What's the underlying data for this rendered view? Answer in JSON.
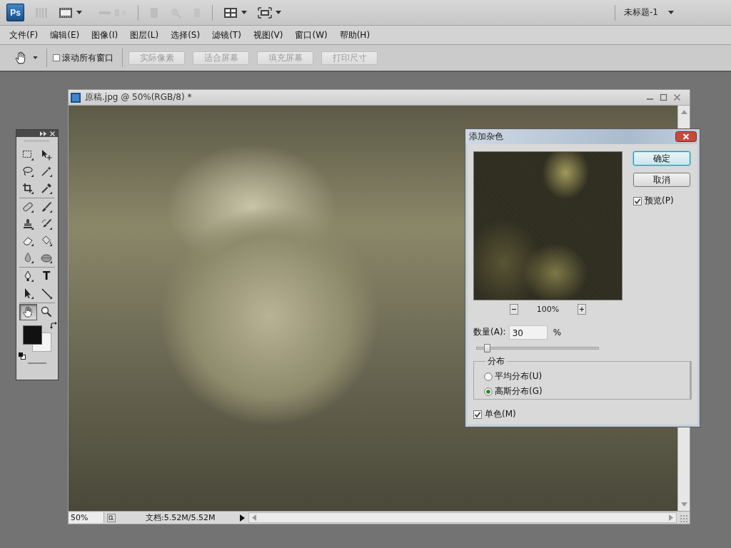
{
  "app_bar": {
    "logo": "Ps",
    "document_tab": "未标题-1"
  },
  "menu": [
    {
      "label": "文件(F)"
    },
    {
      "label": "编辑(E)"
    },
    {
      "label": "图像(I)"
    },
    {
      "label": "图层(L)"
    },
    {
      "label": "选择(S)"
    },
    {
      "label": "滤镜(T)"
    },
    {
      "label": "视图(V)"
    },
    {
      "label": "窗口(W)"
    },
    {
      "label": "帮助(H)"
    }
  ],
  "options_bar": {
    "scroll_all_windows": {
      "label": "滚动所有窗口",
      "checked": false
    },
    "buttons": [
      {
        "label": "实际像素",
        "disabled": true
      },
      {
        "label": "适合屏幕",
        "disabled": true
      },
      {
        "label": "填充屏幕",
        "disabled": true
      },
      {
        "label": "打印尺寸",
        "disabled": true
      }
    ]
  },
  "toolbox": {
    "tool_groups": [
      {
        "tools": [
          {
            "selected": false
          },
          {
            "selected": false
          },
          {
            "selected": false
          },
          {
            "selected": false
          },
          {
            "selected": false
          },
          {
            "selected": false
          }
        ]
      },
      {
        "tools": [
          {
            "selected": false
          },
          {
            "selected": false
          },
          {
            "selected": false
          },
          {
            "selected": false
          },
          {
            "selected": false
          },
          {
            "selected": false
          },
          {
            "selected": false
          },
          {
            "selected": false
          }
        ]
      },
      {
        "tools": [
          {
            "selected": false
          },
          {
            "label": "T",
            "selected": false
          },
          {
            "selected": false
          },
          {
            "selected": false
          }
        ]
      },
      {
        "tools": [
          {
            "selected": true
          },
          {
            "selected": false
          }
        ]
      }
    ],
    "swatches": [
      {
        "color": "#111111"
      },
      {
        "color": "#f4f4f4"
      }
    ]
  },
  "document": {
    "title": "原稿.jpg @ 50%(RGB/8) *",
    "zoom": "50%",
    "size_info": "文档:5.52M/5.52M"
  },
  "dialog": {
    "title": "添加杂色",
    "preview_zoom": "100%",
    "buttons": [
      {
        "label": "确定",
        "default": true
      },
      {
        "label": "取消",
        "default": false
      }
    ],
    "preview": {
      "label": "预览(P)",
      "checked": true
    },
    "amount": {
      "label": "数量(A):",
      "value": "30",
      "unit": "%",
      "level": 0.08
    },
    "distribution": {
      "label": "分布",
      "options": [
        {
          "label": "平均分布(U)",
          "selected": false
        },
        {
          "label": "高斯分布(G)",
          "selected": true
        }
      ]
    },
    "monochrome": {
      "label": "单色(M)",
      "checked": true
    }
  }
}
